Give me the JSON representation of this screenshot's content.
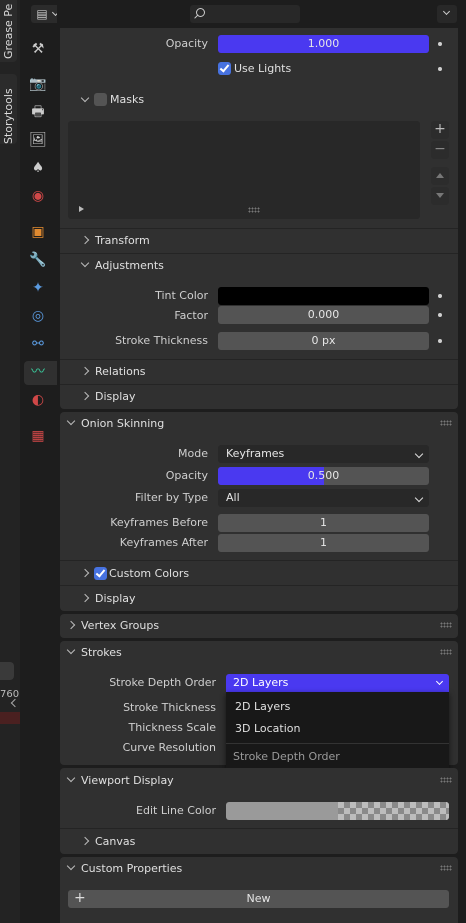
{
  "left_tabs": [
    "Grease Pe",
    "Storytools"
  ],
  "partial_value": "760",
  "search": {
    "placeholder": ""
  },
  "layer": {
    "opacity_label": "Opacity",
    "opacity_value": "1.000",
    "use_lights_label": "Use Lights",
    "masks_label": "Masks",
    "transform_label": "Transform",
    "adjustments_label": "Adjustments",
    "tint_color_label": "Tint Color",
    "factor_label": "Factor",
    "factor_value": "0.000",
    "stroke_thickness_label": "Stroke Thickness",
    "stroke_thickness_value": "0 px",
    "relations_label": "Relations",
    "display_label": "Display"
  },
  "onion": {
    "title": "Onion Skinning",
    "mode_label": "Mode",
    "mode_value": "Keyframes",
    "opacity_label": "Opacity",
    "opacity_value": "0.500",
    "filter_label": "Filter by Type",
    "filter_value": "All",
    "before_label": "Keyframes Before",
    "before_value": "1",
    "after_label": "Keyframes After",
    "after_value": "1",
    "custom_colors_label": "Custom Colors",
    "display_label": "Display"
  },
  "vertex_groups": {
    "title": "Vertex Groups"
  },
  "strokes": {
    "title": "Strokes",
    "depth_order_label": "Stroke Depth Order",
    "depth_order_value": "2D Layers",
    "thickness_label": "Stroke Thickness",
    "thickness_scale_label": "Thickness Scale",
    "curve_resolution_label": "Curve Resolution"
  },
  "dropdown_menu": {
    "options": [
      "2D Layers",
      "3D Location"
    ],
    "footer": "Stroke Depth Order"
  },
  "viewport_display": {
    "title": "Viewport Display",
    "edit_line_color_label": "Edit Line Color",
    "canvas_label": "Canvas"
  },
  "custom_properties": {
    "title": "Custom Properties",
    "new_label": "New"
  },
  "colors": {
    "accent": "#4a39f0",
    "checkbox": "#4772e0",
    "panel": "#303030",
    "background": "#1d1d1d"
  }
}
